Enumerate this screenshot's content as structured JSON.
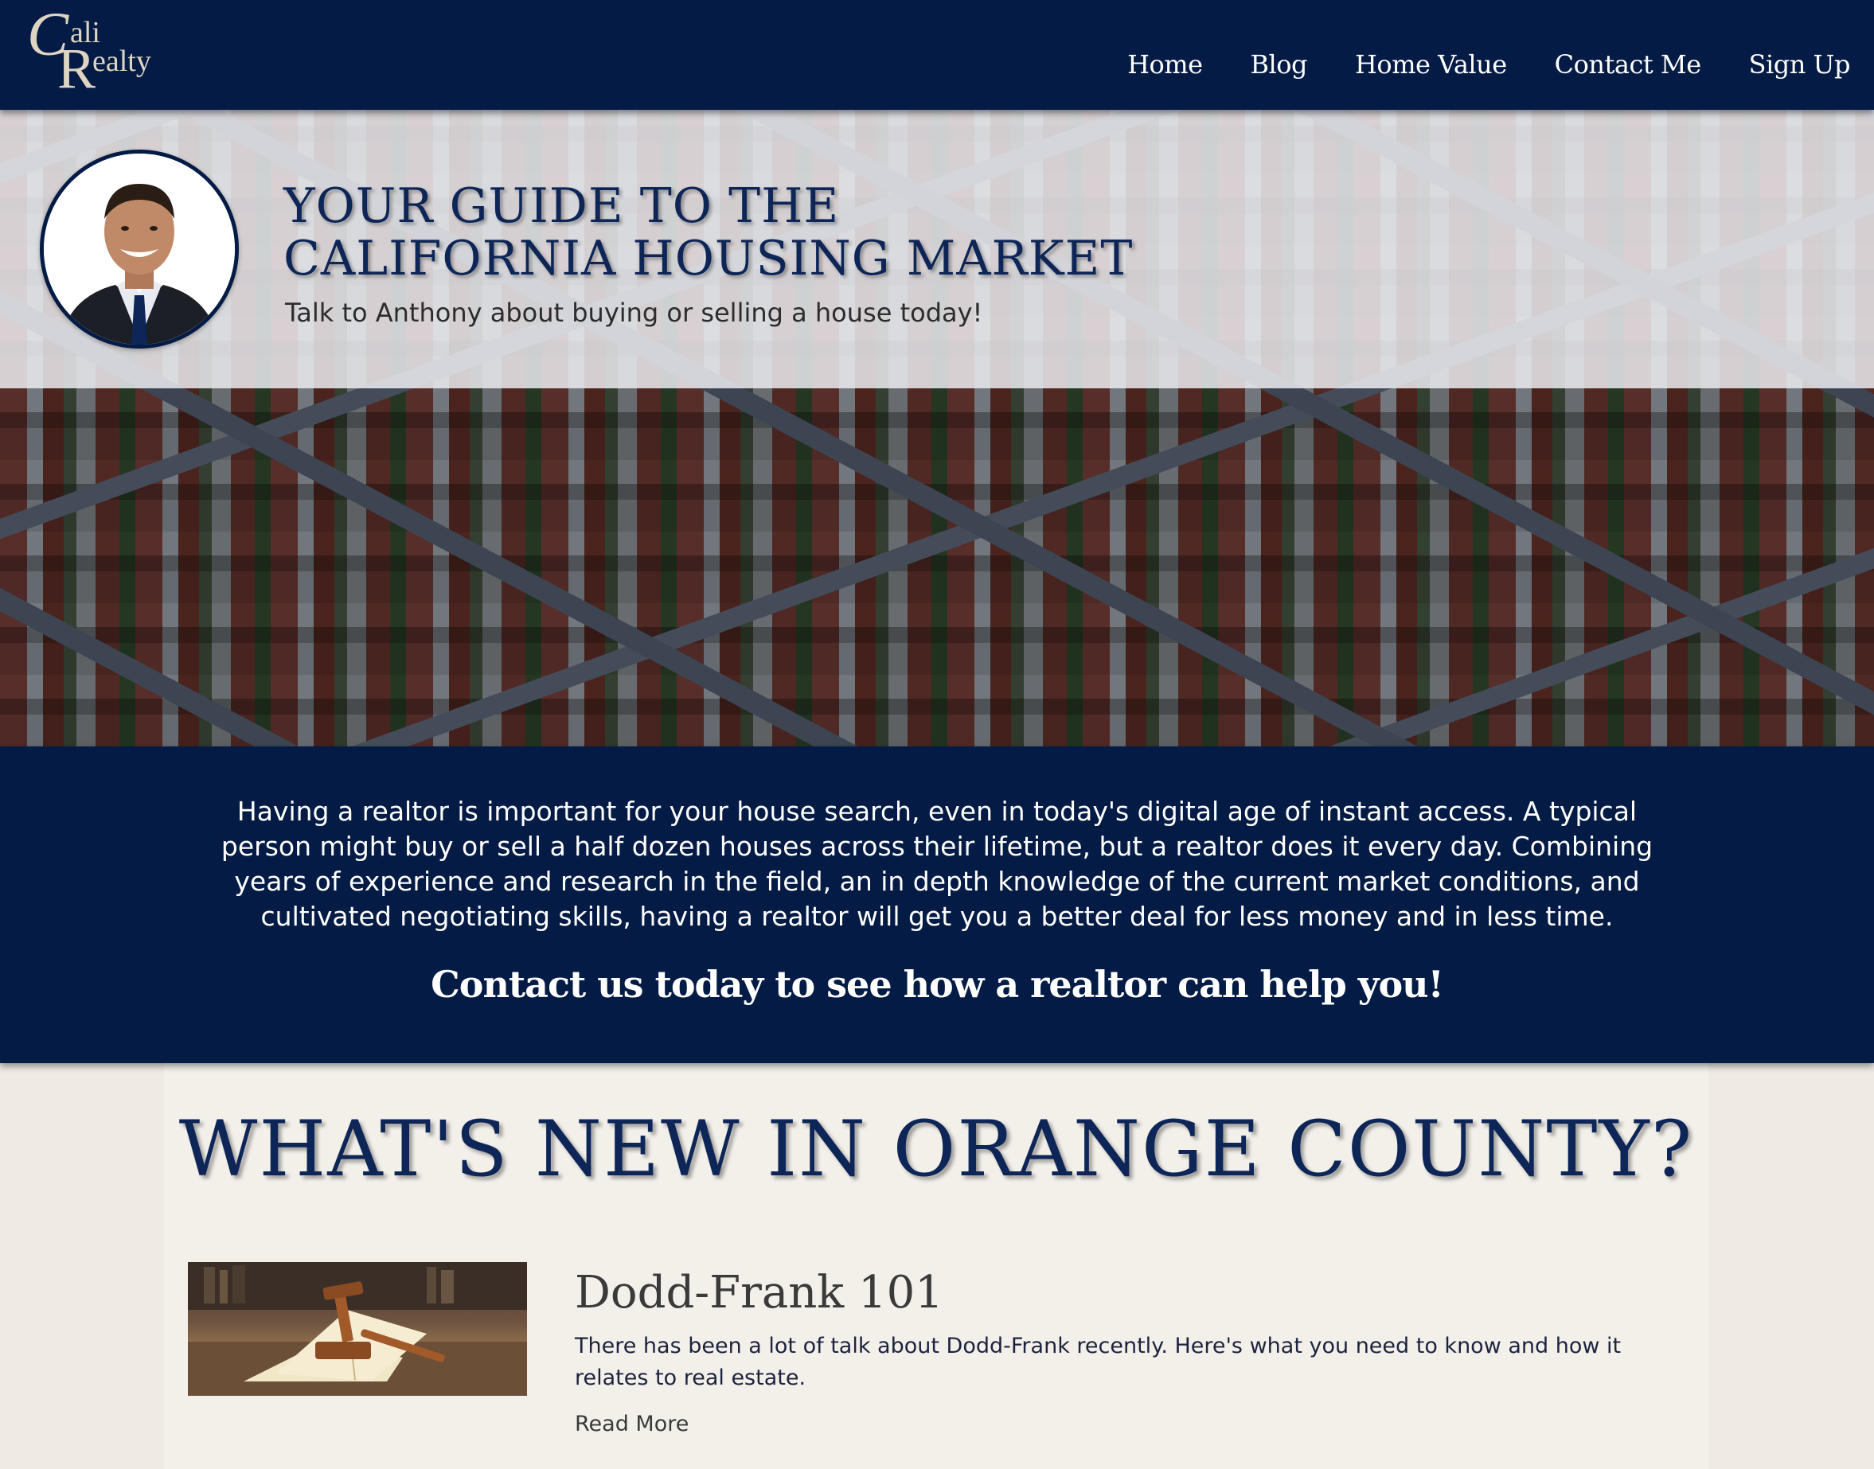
{
  "header": {
    "logo": {
      "c": "C",
      "ali": "ali",
      "r": "R",
      "ealty": "ealty"
    },
    "nav": [
      "Home",
      "Blog",
      "Home Value",
      "Contact Me",
      "Sign Up"
    ]
  },
  "hero": {
    "title_line1": "YOUR GUIDE TO THE",
    "title_line2": "CALIFORNIA HOUSING MARKET",
    "subtitle": "Talk to Anthony about buying or selling a house today!",
    "avatar_icon": "person-photo"
  },
  "info": {
    "text": "Having a realtor is important for your house search, even in today's digital age of instant access. A typical person might buy or sell a half dozen houses across their lifetime, but a realtor does it every day. Combining years of experience and research in the field, an in depth knowledge of the current market conditions, and cultivated negotiating skills, having a realtor will get you a better deal for less money and in less time.",
    "cta": "Contact us today to see how a realtor can help you!"
  },
  "news": {
    "title": "WHAT'S NEW IN ORANGE COUNTY?",
    "posts": [
      {
        "title": "Dodd-Frank 101",
        "excerpt": "There has been a lot of talk about Dodd-Frank recently. Here's what you need to know and how it relates to real estate.",
        "read_more": "Read More",
        "thumb_icon": "law-book-gavel-image"
      }
    ]
  },
  "colors": {
    "navy": "#041b45",
    "title_blue": "#0d2557",
    "logo_cream": "#ddd5c2",
    "page_bg": "#efeae2"
  }
}
